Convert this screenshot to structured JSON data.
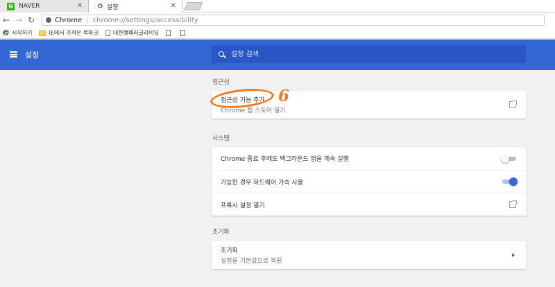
{
  "browser": {
    "tabs": [
      {
        "label": "NAVER",
        "favicon": "N"
      },
      {
        "label": "설정"
      }
    ],
    "omnibox": {
      "brand": "Chrome",
      "separator": "|",
      "url": "chrome://settings/accessibility"
    },
    "bookmarks": [
      {
        "label": "시작하기",
        "icon": "chrome-icon"
      },
      {
        "label": "IE에서 가져온 북마크",
        "icon": "folder-icon"
      },
      {
        "label": "대한행패러글라이딩",
        "icon": "page-icon"
      },
      {
        "label": "",
        "icon": "page-icon"
      },
      {
        "label": "",
        "icon": "page-icon"
      }
    ]
  },
  "appbar": {
    "title": "설정",
    "search_placeholder": "설정 검색",
    "color": "#3367d6"
  },
  "sections": {
    "accessibility": {
      "title": "접근성",
      "items": [
        {
          "label": "접근성 기능 추가",
          "sub": "Chrome 웹 스토어 열기"
        }
      ]
    },
    "system": {
      "title": "시스템",
      "items": [
        {
          "label": "Chrome 종료 후에도 백그라운드 앱을 계속 실행",
          "toggle": false
        },
        {
          "label": "가능한 경우 하드웨어 가속 사용",
          "toggle": true
        },
        {
          "label": "프록시 설정 열기"
        }
      ]
    },
    "reset": {
      "title": "초기화",
      "items": [
        {
          "label": "초기화",
          "sub": "설정을 기본값으로 복원"
        }
      ]
    }
  },
  "annotation": {
    "number": "6",
    "color": "#f07b1e"
  }
}
